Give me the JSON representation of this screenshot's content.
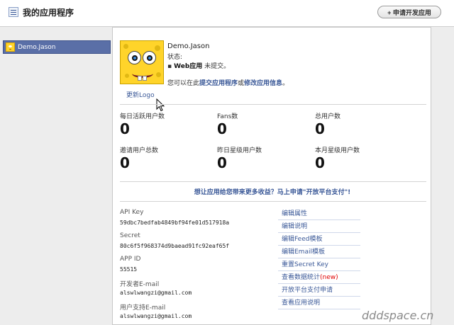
{
  "header": {
    "title": "我的应用程序",
    "new_app_button": "+ 申请开发应用"
  },
  "sidebar": {
    "items": [
      {
        "label": "Demo.Jason"
      }
    ]
  },
  "app": {
    "name": "Demo.Jason",
    "status_label": "状态:",
    "status_item_bullet": "▪",
    "status_item_type": "Web应用",
    "status_item_state": "未提交。",
    "desc_prefix": "您可以在此",
    "desc_link1": "提交应用程序",
    "desc_mid": "或",
    "desc_link2": "修改应用信息",
    "desc_suffix": "。",
    "update_logo": "更新Logo"
  },
  "stats": [
    {
      "label": "每日活跃用户数",
      "value": "0"
    },
    {
      "label": "Fans数",
      "value": "0"
    },
    {
      "label": "总用户数",
      "value": "0"
    },
    {
      "label": "邀请用户总数",
      "value": "0"
    },
    {
      "label": "昨日星级用户数",
      "value": "0"
    },
    {
      "label": "本月星级用户数",
      "value": "0"
    }
  ],
  "promo": "想让应用给您带来更多收益？马上申请\"开放平台支付\"!",
  "info": [
    {
      "label": "API Key",
      "value": "59dbc7bedfab4849bf94fe01d517918a"
    },
    {
      "label": "Secret",
      "value": "80c6f5f968374d9baead91fc92eaf65f"
    },
    {
      "label": "APP ID",
      "value": "55515"
    },
    {
      "label": "开发者E-mail",
      "value": "alswlwangzi@gmail.com"
    },
    {
      "label": "用户支持E-mail",
      "value": "alswlwangzi@gmail.com"
    }
  ],
  "actions": [
    {
      "label": "编辑属性"
    },
    {
      "label": "编辑说明"
    },
    {
      "label": "编辑Feed模板"
    },
    {
      "label": "编辑Email模板"
    },
    {
      "label": "重置Secret Key"
    },
    {
      "label": "查看数据统计",
      "badge": "(new)"
    },
    {
      "label": "开放平台支付申请"
    },
    {
      "label": "查看应用说明"
    }
  ],
  "watermark": "dddspace.cn",
  "colors": {
    "link": "#3b5998",
    "sidebar_selected": "#5a6fa7",
    "new_badge": "#e00000",
    "avatar_yellow": "#ffd42a"
  }
}
